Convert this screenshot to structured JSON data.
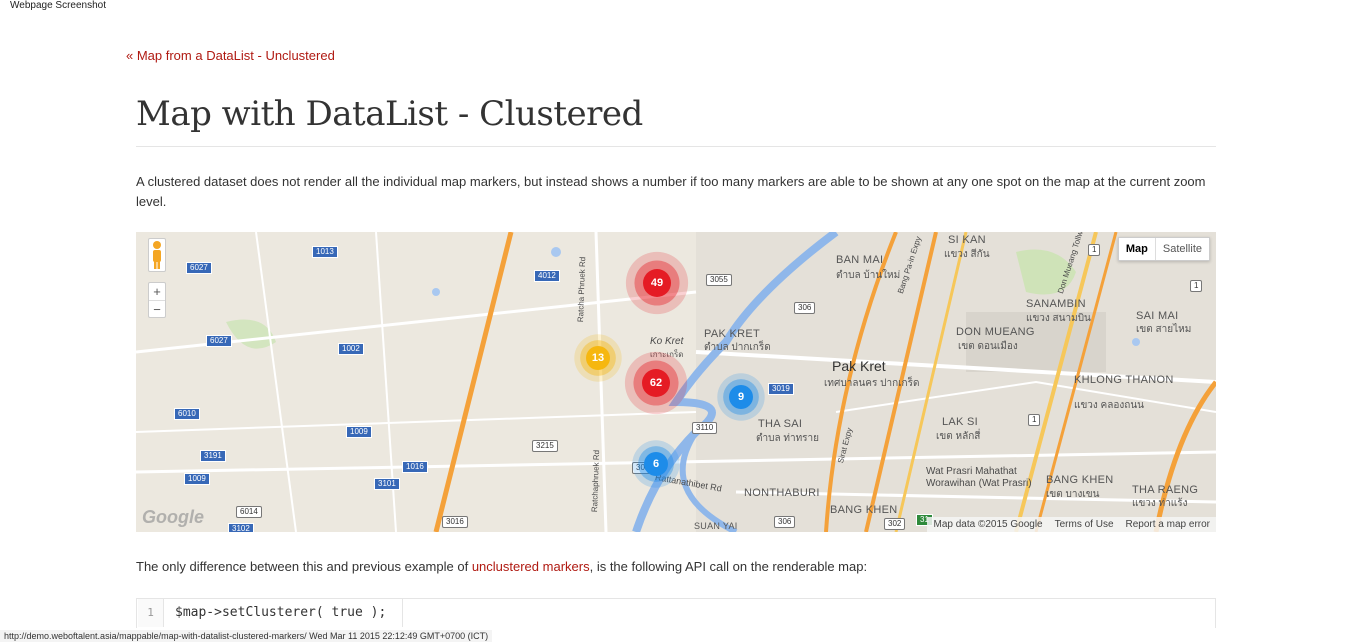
{
  "screenshot_title": "Webpage Screenshot",
  "back_link": "« Map from a DataList - Unclustered",
  "page_title": "Map with DataList - Clustered",
  "intro": "A clustered dataset does not render all the individual map markers, but instead shows a number if too many markers are able to be shown at any one spot on the map at the current zoom level.",
  "map": {
    "controls": {
      "zoom_in": "+",
      "zoom_out": "−"
    },
    "maptype": {
      "map": "Map",
      "satellite": "Satellite"
    },
    "clusters": [
      {
        "count": "49",
        "color": "#e51b24"
      },
      {
        "count": "13",
        "color": "#f6b70f"
      },
      {
        "count": "62",
        "color": "#e51b24"
      },
      {
        "count": "9",
        "color": "#1d8ce9"
      },
      {
        "count": "6",
        "color": "#1d8ce9"
      }
    ],
    "labels": {
      "ban_mai": "BAN MAI",
      "ban_mai_th": "ตำบล บ้านใหม่",
      "si_kan": "SI KAN",
      "si_kan_th": "แขวง สีกัน",
      "sanambin": "SANAMBIN",
      "sanambin_th": "แขวง สนามบิน",
      "sai_mai": "SAI MAI",
      "sai_mai_th": "เขต สายไหม",
      "don_mueang": "DON MUEANG",
      "don_mueang_th": "เขต ดอนเมือง",
      "pak_kret_caps": "PAK KRET",
      "pak_kret_caps_th": "ตำบล ปากเกร็ด",
      "pak_kret": "Pak Kret",
      "pak_kret_th": "เทศบาลนคร ปากเกร็ด",
      "ko_kret": "Ko Kret",
      "ko_kret_th": "เกาะเกร็ด",
      "khlong_thanon": "KHLONG THANON",
      "khlong_thanon_th": "แขวง คลองถนน",
      "lak_si": "LAK SI",
      "lak_si_th": "เขต หลักสี่",
      "tha_sai": "THA SAI",
      "tha_sai_th": "ตำบล ท่าทราย",
      "wat_prasri": "Wat Prasri Mahathat Worawihan (Wat Prasri)",
      "bang_khen": "BANG KHEN",
      "bang_khen_th": "เขต บางเขน",
      "tha_raeng": "THA RAENG",
      "tha_raeng_th": "แขวง ท่าแร้ง",
      "nonthaburi": "NONTHABURI",
      "suan_yai": "SUAN YAI",
      "ratcha_road": "Ratcha Phruek Rd",
      "ratchaphruek_road": "Ratchaphruek Rd",
      "rattanathibet": "Rattanathibet Rd",
      "srirat": "Sirat Expy",
      "bang_pa_in": "Bang Pa-in Expy",
      "don_mueang_tollway": "Don Mueang Tollway"
    },
    "road_numbers": [
      "1013",
      "6027",
      "4012",
      "3055",
      "306",
      "6027",
      "1002",
      "3019",
      "6010",
      "1009",
      "3191",
      "1016",
      "1009",
      "3101",
      "3215",
      "3110",
      "6014",
      "3102",
      "3016",
      "306",
      "302",
      "1",
      "1",
      "1",
      "31",
      "3021"
    ],
    "google_logo": "Google",
    "attribution": {
      "data": "Map data ©2015 Google",
      "terms": "Terms of Use",
      "report": "Report a map error"
    }
  },
  "diff_text": {
    "before": "The only difference between this and previous example of ",
    "link": "unclustered markers",
    "after": ", is the following API call on the renderable map:"
  },
  "code": {
    "line_number": "1",
    "source": "$map->setClusterer( true );"
  },
  "status_bar": "http://demo.weboftalent.asia/mappable/map-with-datalist-clustered-markers/ Wed Mar 11 2015 22:12:49 GMT+0700 (ICT)"
}
